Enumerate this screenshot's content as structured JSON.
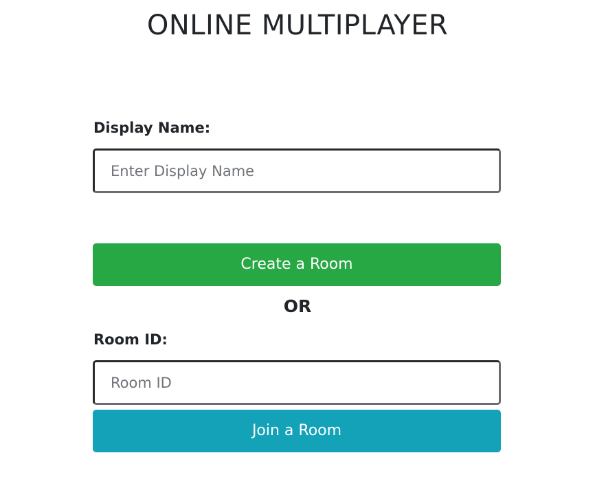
{
  "title": "ONLINE MULTIPLAYER",
  "display_name": {
    "label": "Display Name:",
    "placeholder": "Enter Display Name",
    "value": ""
  },
  "create_button": {
    "label": "Create a Room"
  },
  "separator": "OR",
  "room_id": {
    "label": "Room ID:",
    "placeholder": "Room ID",
    "value": ""
  },
  "join_button": {
    "label": "Join a Room"
  },
  "colors": {
    "create_button": "#28a745",
    "join_button": "#14a2b8",
    "text": "#212529"
  }
}
